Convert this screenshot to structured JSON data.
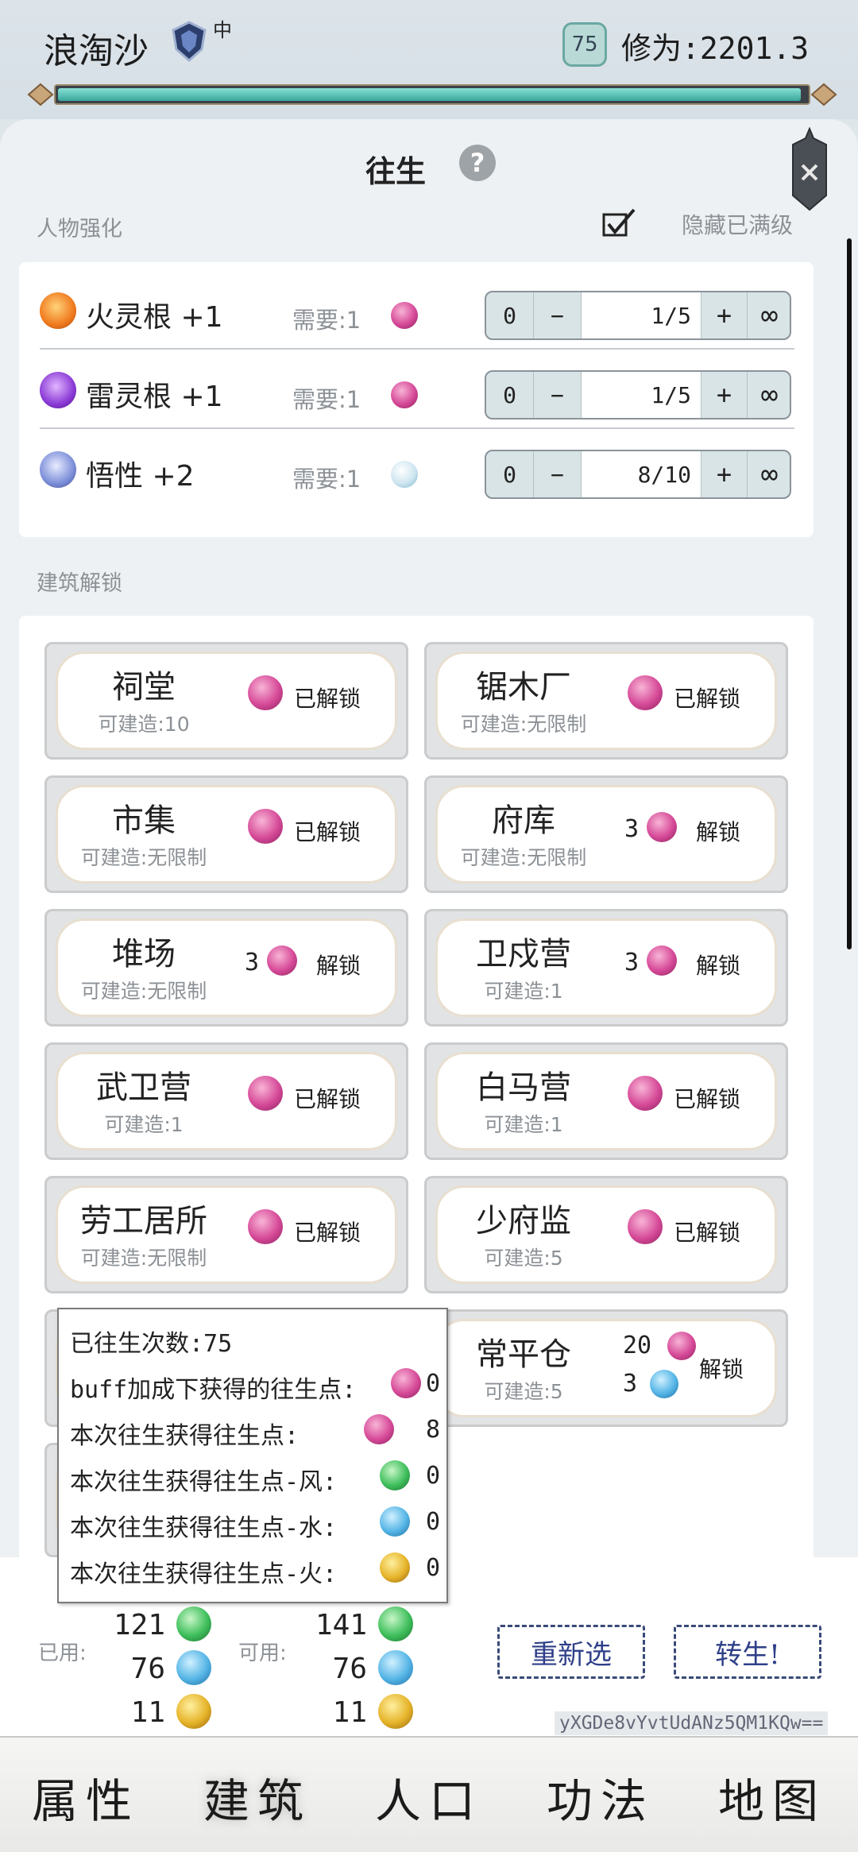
{
  "header": {
    "player_name": "浪淘沙",
    "rank_label": "中",
    "level": "75",
    "cultivation_label": "修为:2201.3",
    "progress_fraction": 0.99
  },
  "panel": {
    "title": "往生",
    "help": "?",
    "section_attributes": "人物强化",
    "hide_maxed_label": "隐藏已满级",
    "section_buildings": "建筑解锁"
  },
  "attributes": [
    {
      "name": "火灵根 +1",
      "icon": "fire-root-icon",
      "need_label": "需要:1",
      "zero": "0",
      "minus": "−",
      "value": "1/5",
      "plus": "+",
      "inf": "∞"
    },
    {
      "name": "雷灵根 +1",
      "icon": "thunder-root-icon",
      "need_label": "需要:1",
      "zero": "0",
      "minus": "−",
      "value": "1/5",
      "plus": "+",
      "inf": "∞"
    },
    {
      "name": "悟性 +2",
      "icon": "insight-icon",
      "need_label": "需要:1",
      "zero": "0",
      "minus": "−",
      "value": "8/10",
      "plus": "+",
      "inf": "∞"
    }
  ],
  "buildings": [
    {
      "name": "祠堂",
      "sub": "可建造:10",
      "status": "已解锁"
    },
    {
      "name": "锯木厂",
      "sub": "可建造:无限制",
      "status": "已解锁"
    },
    {
      "name": "市集",
      "sub": "可建造:无限制",
      "status": "已解锁"
    },
    {
      "name": "府库",
      "sub": "可建造:无限制",
      "cost": "3",
      "status": "解锁"
    },
    {
      "name": "堆场",
      "sub": "可建造:无限制",
      "cost": "3",
      "status": "解锁"
    },
    {
      "name": "卫戍营",
      "sub": "可建造:1",
      "cost": "3",
      "status": "解锁"
    },
    {
      "name": "武卫营",
      "sub": "可建造:1",
      "status": "已解锁"
    },
    {
      "name": "白马营",
      "sub": "可建造:1",
      "status": "已解锁"
    },
    {
      "name": "劳工居所",
      "sub": "可建造:无限制",
      "status": "已解锁"
    },
    {
      "name": "少府监",
      "sub": "可建造:5",
      "status": "已解锁"
    },
    {
      "name": "常平仓",
      "sub": "可建造:5",
      "cost": "20",
      "cost2": "3",
      "status": "解锁"
    }
  ],
  "tooltip": {
    "rebirth_count": "已往生次数:75",
    "buff_label": "buff加成下获得的往生点:",
    "buff_value": "0",
    "gain_label": "本次往生获得往生点:",
    "gain_value": "8",
    "wind_label": "本次往生获得往生点-风:",
    "wind_value": "0",
    "water_label": "本次往生获得往生点-水:",
    "water_value": "0",
    "fire_label": "本次往生获得往生点-火:",
    "fire_value": "0"
  },
  "points": {
    "used_label": "已用:",
    "available_label": "可用:",
    "used": [
      "121",
      "76",
      "11"
    ],
    "available": [
      "141",
      "76",
      "11"
    ]
  },
  "actions": {
    "reselect": "重新选",
    "rebirth": "转生!"
  },
  "code": "yXGDe8vYvtUdANz5QM1KQw==",
  "nav": [
    "属性",
    "建筑",
    "人口",
    "功法",
    "地图"
  ],
  "colors": {
    "accent": "#2f3f88",
    "progress": "#3ba79c",
    "muted_text": "#8c9196"
  }
}
